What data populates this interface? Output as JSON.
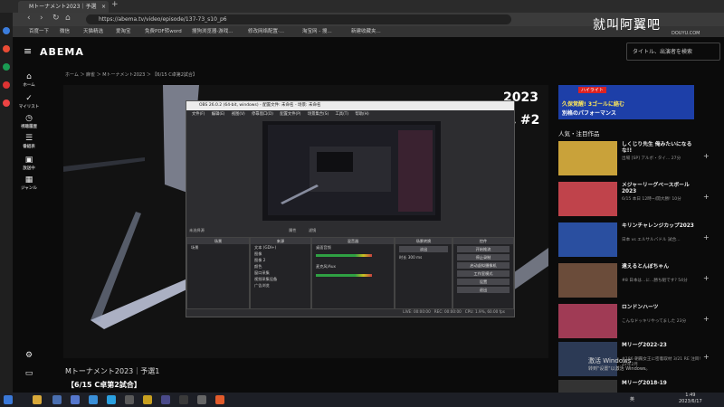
{
  "browser": {
    "tab_title": "Mトーナメント2023｜予選",
    "tab_close": "×",
    "new_tab": "+",
    "url": "https://abema.tv/video/episode/137-73_s10_p6",
    "bookmarks": [
      "百度一下",
      "微信",
      "天猫精选",
      "爱淘宝",
      "免费PDF转word",
      "搜狗浏览器·游戏...",
      "修改网络配置·...",
      "淘宝网 - 搜...",
      "新建收藏夹..."
    ]
  },
  "watermark": {
    "text": "就叫阿翼吧",
    "site": "DOUYU.COM"
  },
  "abema": {
    "logo": "ABEMA",
    "search_placeholder": "タイトル、出演者を検索",
    "nav": [
      {
        "icon": "⌂",
        "label": "ホーム"
      },
      {
        "icon": "✓",
        "label": "マイリスト"
      },
      {
        "icon": "◷",
        "label": "視聴履歴"
      },
      {
        "icon": "☰",
        "label": "番組表"
      },
      {
        "icon": "▣",
        "label": "放送中"
      },
      {
        "icon": "▦",
        "label": "ジャンル"
      }
    ],
    "breadcrumb": "ホーム ＞ 麻雀 ＞ Mトーナメント2023 ＞ 【6/15 C卓第2試合】",
    "overlay_year": "2023",
    "overlay_stage": "卓 #2",
    "video_title": "Mトーナメント2023｜予選1",
    "video_subtitle": "【6/15 C卓第2試合】"
  },
  "obs": {
    "title": "OBS 26.0.2 (64-bit, windows) - 配置文件: 未命名 - 场景: 未命名",
    "menu": [
      "文件(F)",
      "编辑(E)",
      "视图(V)",
      "停靠窗口(D)",
      "配置文件(P)",
      "场景集合(S)",
      "工具(T)",
      "帮助(H)"
    ],
    "no_source": "未选择源",
    "props_label": "属性",
    "filters_label": "滤镜",
    "docks": {
      "scenes": {
        "title": "场景",
        "items": [
          "场景"
        ]
      },
      "sources": {
        "title": "来源",
        "items": [
          "文本 (GDI+)",
          "图像",
          "图像 2",
          "颜色",
          "窗口采集",
          "视频采集设备",
          "广告浏览"
        ]
      },
      "mixer": {
        "title": "混音器",
        "channels": [
          "桌面音频",
          "麦克风/Aux"
        ]
      },
      "transitions": {
        "title": "场景转换",
        "type": "淡出",
        "duration_label": "时长",
        "duration": "300 ms"
      },
      "controls": {
        "title": "控件",
        "buttons": [
          "开始推流",
          "停止录制",
          "启动虚拟摄像机",
          "工作室模式",
          "设置",
          "退出"
        ]
      }
    },
    "status": {
      "live": "LIVE: 00:00:00",
      "rec": "REC: 00:00:00",
      "cpu": "CPU: 1.9%, 60.00 fps"
    }
  },
  "right": {
    "banner": {
      "tag": "ハイライト",
      "line1": "久保覚醒! 3ゴールに絡む",
      "line2": "別格のパフォーマンス"
    },
    "section_title": "人気・注目作品",
    "items": [
      {
        "title": "しくじり先生 俺みたいになるな!!",
        "sub": "出場 [SP] アルボ・タイ... 27分"
      },
      {
        "title": "メジャーリーグベースボール2023",
        "sub": "6/15 本日 12時~/開大勝! 10分"
      },
      {
        "title": "キリンチャレンジカップ2023",
        "sub": "日本 vs エルサルバドル 試合..."
      },
      {
        "title": "遠えるとんぼちゃん",
        "sub": "#8 日本は...に...勝ち組です? 54分"
      },
      {
        "title": "ロンドンハーツ",
        "sub": "こんなドッキリやってました 23分"
      },
      {
        "title": "Mリーグ2022-23",
        "sub": "#186 朝霧女王に密着取材 3/21 RE 注目! 22年2月"
      },
      {
        "title": "Mリーグ2018-19",
        "sub": ""
      }
    ],
    "windows_activate": "激活 Windows",
    "windows_activate_sub": "转到\"设置\"以激活 Windows。"
  },
  "taskbar": {
    "lang": "英",
    "time": "1:49",
    "date": "2023/6/17"
  }
}
